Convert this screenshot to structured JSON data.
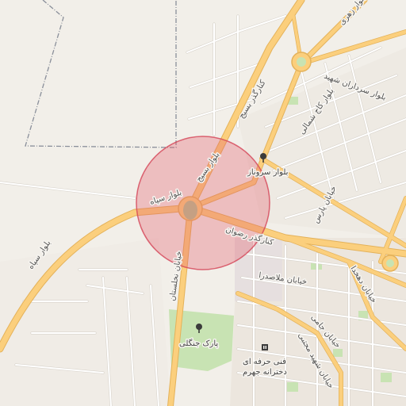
{
  "map": {
    "colors": {
      "background": "#f2efe9",
      "major_road": "#fbcf7d",
      "major_road_casing": "#e4b25a",
      "minor_road": "#ffffff",
      "minor_road_casing": "#d8d3cb",
      "park": "#c8e3b3",
      "urban": "#ece6de",
      "boundary": "#8a8f9a",
      "highlight_fill": "#e45a6a",
      "highlight_stroke": "#d44456",
      "roundabout_center": "#b7c28f"
    },
    "highlight": {
      "shape": "circle",
      "meaning": "selected area"
    },
    "road_labels": {
      "bolvar_shahid_zahri": "بلوار زهری",
      "bolvar_sardaran_shahid": "بلوار سرداران شهید",
      "kaj_shomali": "بلوار کاج شمالی",
      "kamarbandi_basij": "کنارگذر بسیج",
      "bolvar_basij": "بلوار بسیج",
      "bolvar_sepah_upper": "بلوار سپاه",
      "bolvar_sepah_lower": "بلوار سپاه",
      "kamarbandi_rezvan": "کنارگذر رضوان",
      "khiaban_pars": "خیابان پارس",
      "khiaban_nakhlestan": "خیابان نخلستان",
      "khiaban_mollasadra": "خیابان ملاصدرا",
      "khiaban_dehkhoda": "خیابان دهخدا",
      "khiaban_shahid_mojtaba": "خیابان شهید مجتبی",
      "khiaban_jami": "خیابان جامی"
    },
    "pois": {
      "bolvar_sarvenaz": {
        "label": "بلوار سروناز",
        "icon": "tree-icon"
      },
      "park_jangali": {
        "label": "پارک جنگلی",
        "icon": "tree-icon"
      },
      "school_line1": "فنی حرفه ای",
      "school_line2": "دخترانه جهرم",
      "school_icon": "school-icon"
    }
  }
}
